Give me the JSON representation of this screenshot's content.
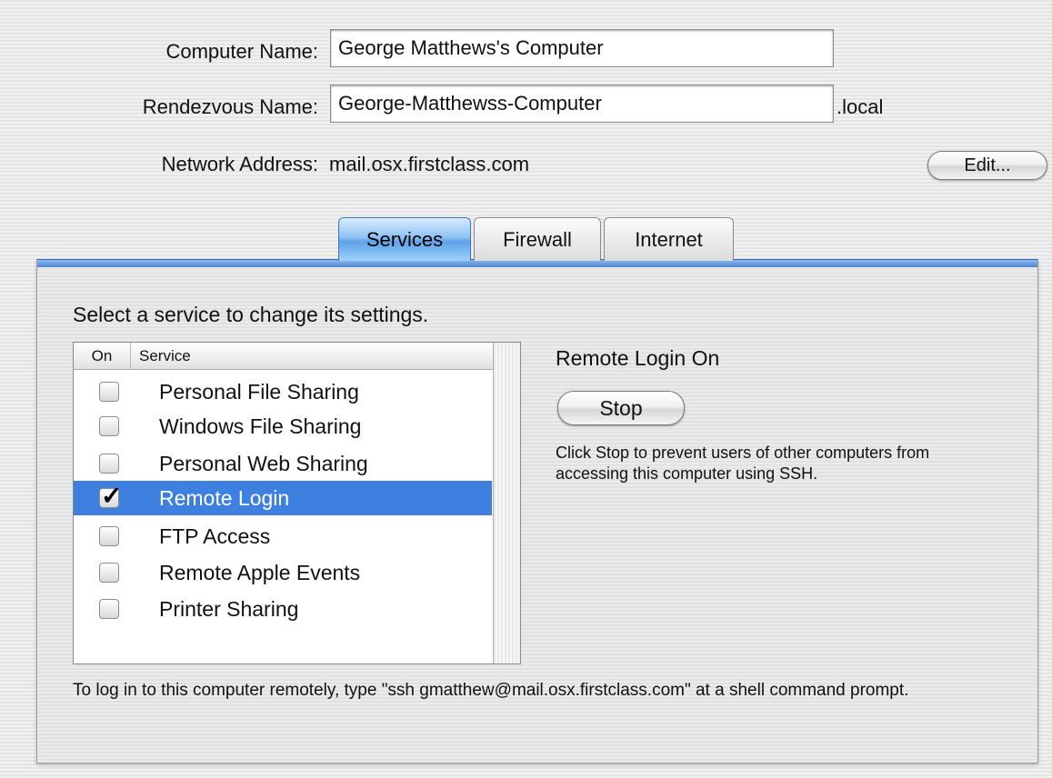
{
  "identity": {
    "computer_name_label": "Computer Name:",
    "computer_name_value": "George Matthews's Computer",
    "rendezvous_label": "Rendezvous Name:",
    "rendezvous_value": "George-Matthewss-Computer",
    "rendezvous_suffix": ".local",
    "network_label": "Network Address:",
    "network_value": "mail.osx.firstclass.com",
    "edit_button": "Edit..."
  },
  "tabs": [
    {
      "label": "Services",
      "active": true
    },
    {
      "label": "Firewall",
      "active": false
    },
    {
      "label": "Internet",
      "active": false
    }
  ],
  "services_pane": {
    "instruction": "Select a service to change its settings.",
    "columns": {
      "on": "On",
      "service": "Service"
    },
    "services": [
      {
        "label": "Personal File Sharing",
        "on": false,
        "selected": false
      },
      {
        "label": "Windows File Sharing",
        "on": false,
        "selected": false
      },
      {
        "label": "Personal Web Sharing",
        "on": false,
        "selected": false
      },
      {
        "label": "Remote Login",
        "on": true,
        "selected": true
      },
      {
        "label": "FTP Access",
        "on": false,
        "selected": false
      },
      {
        "label": "Remote Apple Events",
        "on": false,
        "selected": false
      },
      {
        "label": "Printer Sharing",
        "on": false,
        "selected": false
      }
    ],
    "status_title": "Remote Login On",
    "stop_button": "Stop",
    "description": "Click Stop to prevent users of other computers from accessing this computer using SSH.",
    "footer": "To log in to this computer remotely, type \"ssh gmatthew@mail.osx.firstclass.com\" at a shell command prompt."
  },
  "colors": {
    "selection": "#3d80df",
    "tab_active": "#5ea2e6"
  }
}
